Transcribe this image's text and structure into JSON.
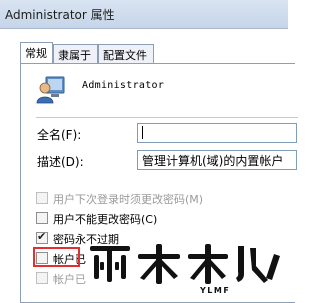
{
  "window": {
    "title": "Administrator 属性"
  },
  "tabs": [
    {
      "label": "常规"
    },
    {
      "label": "隶属于"
    },
    {
      "label": "配置文件"
    }
  ],
  "user": {
    "name": "Administrator",
    "icon": "user-icon"
  },
  "fields": {
    "fullname": {
      "label": "全名(F):",
      "value": ""
    },
    "description": {
      "label": "描述(D):",
      "value": "管理计算机(域)的内置帐户"
    }
  },
  "options": [
    {
      "label": "用户下次登录时须更改密码(M)",
      "checked": false,
      "disabled": true
    },
    {
      "label": "用户不能更改密码(C)",
      "checked": false,
      "disabled": false
    },
    {
      "label": "密码永不过期",
      "checked": true,
      "disabled": false
    },
    {
      "label": "帐户已",
      "checked": false,
      "disabled": false
    },
    {
      "label": "帐户已",
      "checked": false,
      "disabled": true
    }
  ],
  "watermark": {
    "logo_text": "雨林木风",
    "sub_text": "YLMF"
  }
}
